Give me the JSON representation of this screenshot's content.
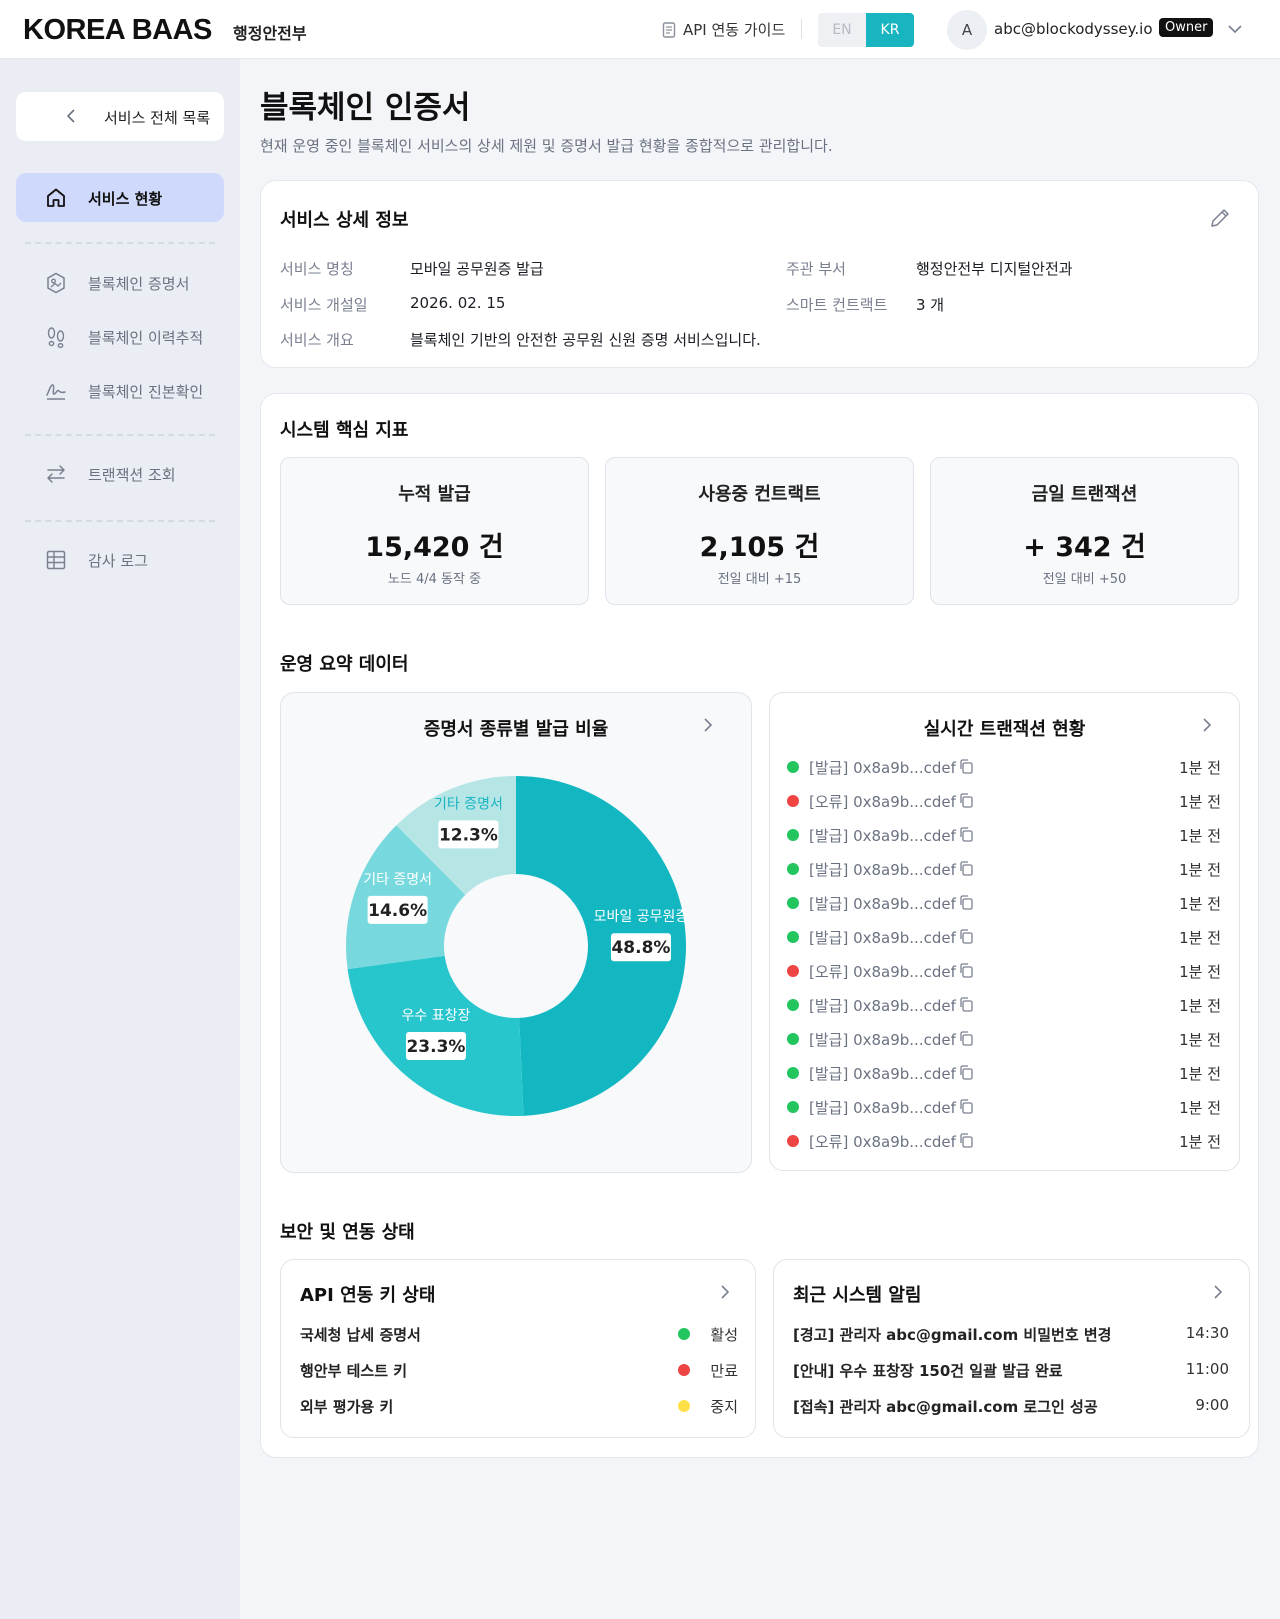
{
  "header": {
    "logo": "KOREA BAAS",
    "org": "행정안전부",
    "api_guide": "API 연동 가이드",
    "lang_en": "EN",
    "lang_kr": "KR",
    "avatar_initial": "A",
    "email": "abc@blockodyssey.io",
    "role": "Owner"
  },
  "sidebar": {
    "back_label": "서비스 전체 목록",
    "items": [
      {
        "label": "서비스 현황",
        "icon": "home-icon"
      },
      {
        "label": "블록체인 증명서",
        "icon": "certificate-icon"
      },
      {
        "label": "블록체인 이력추적",
        "icon": "footprints-icon"
      },
      {
        "label": "블록체인 진본확인",
        "icon": "signature-icon"
      },
      {
        "label": "트랜잭션 조회",
        "icon": "transfer-arrows-icon"
      },
      {
        "label": "감사 로그",
        "icon": "table-icon"
      }
    ]
  },
  "page": {
    "title": "블록체인 인증서",
    "subtitle": "현재 운영 중인 블록체인 서비스의 상세 제원 및 증명서 발급 현황을 종합적으로 관리합니다."
  },
  "service_info": {
    "title": "서비스 상세 정보",
    "name_label": "서비스 명칭",
    "name_value": "모바일 공무원증 발급",
    "dept_label": "주관 부서",
    "dept_value": "행정안전부 디지털안전과",
    "date_label": "서비스 개설일",
    "date_value": "2026. 02. 15",
    "contract_label": "스마트 컨트랙트",
    "contract_value": "3 개",
    "summary_label": "서비스 개요",
    "summary_value": "블록체인 기반의 안전한 공무원 신원 증명 서비스입니다."
  },
  "kpi": {
    "title": "시스템 핵심 지표",
    "items": [
      {
        "title": "누적 발급",
        "value": "15,420 건",
        "sub": "노드 4/4 동작 중"
      },
      {
        "title": "사용중 컨트랙트",
        "value": "2,105 건",
        "sub": "전일 대비 +15"
      },
      {
        "title": "금일 트랜잭션",
        "value": "+ 342 건",
        "sub": "전일 대비 +50"
      }
    ]
  },
  "summary": {
    "title": "운영 요약 데이터",
    "pie_title": "증명서 종류별 발급 비율",
    "tx_title": "실시간 트랜잭션 현황"
  },
  "chart_data": {
    "type": "pie",
    "title": "증명서 종류별 발급 비율",
    "categories": [
      "모바일 공무원증",
      "우수 표창장",
      "기타 증명서",
      "기타 증명서"
    ],
    "values": [
      48.8,
      23.3,
      14.6,
      12.3
    ],
    "labels": [
      "48.8%",
      "23.3%",
      "14.6%",
      "12.3%"
    ],
    "colors": [
      "#13b7c2",
      "#27c6cd",
      "#77d9dd",
      "#b6e5e6"
    ]
  },
  "transactions": [
    {
      "text": "[발급] 0x8a9b...cdef",
      "time": "1분 전",
      "status": "ok"
    },
    {
      "text": "[오류] 0x8a9b...cdef",
      "time": "1분 전",
      "status": "error"
    },
    {
      "text": "[발급] 0x8a9b...cdef",
      "time": "1분 전",
      "status": "ok"
    },
    {
      "text": "[발급] 0x8a9b...cdef",
      "time": "1분 전",
      "status": "ok"
    },
    {
      "text": "[발급] 0x8a9b...cdef",
      "time": "1분 전",
      "status": "ok"
    },
    {
      "text": "[발급] 0x8a9b...cdef",
      "time": "1분 전",
      "status": "ok"
    },
    {
      "text": "[오류] 0x8a9b...cdef",
      "time": "1분 전",
      "status": "error"
    },
    {
      "text": "[발급] 0x8a9b...cdef",
      "time": "1분 전",
      "status": "ok"
    },
    {
      "text": "[발급] 0x8a9b...cdef",
      "time": "1분 전",
      "status": "ok"
    },
    {
      "text": "[발급] 0x8a9b...cdef",
      "time": "1분 전",
      "status": "ok"
    },
    {
      "text": "[발급] 0x8a9b...cdef",
      "time": "1분 전",
      "status": "ok"
    },
    {
      "text": "[오류] 0x8a9b...cdef",
      "time": "1분 전",
      "status": "error"
    }
  ],
  "security": {
    "title": "보안 및 연동 상태",
    "api_title": "API 연동 키 상태",
    "api_keys": [
      {
        "name": "국세청 납세 증명서",
        "status": "활성",
        "color": "#22c55e"
      },
      {
        "name": "행안부 테스트 키",
        "status": "만료",
        "color": "#ef4444"
      },
      {
        "name": "외부 평가용 키",
        "status": "중지",
        "color": "#fde047"
      }
    ],
    "alert_title": "최근 시스템 알림",
    "alerts": [
      {
        "msg": "[경고] 관리자 abc@gmail.com 비밀번호 변경",
        "time": "14:30"
      },
      {
        "msg": "[안내] 우수 표창장 150건 일괄 발급 완료",
        "time": "11:00"
      },
      {
        "msg": "[접속] 관리자 abc@gmail.com 로그인 성공",
        "time": "9:00"
      }
    ]
  },
  "colors": {
    "accent": "#18b4c0",
    "ok": "#22c55e",
    "error": "#ef4444",
    "active_nav": "#cfd9fb"
  }
}
